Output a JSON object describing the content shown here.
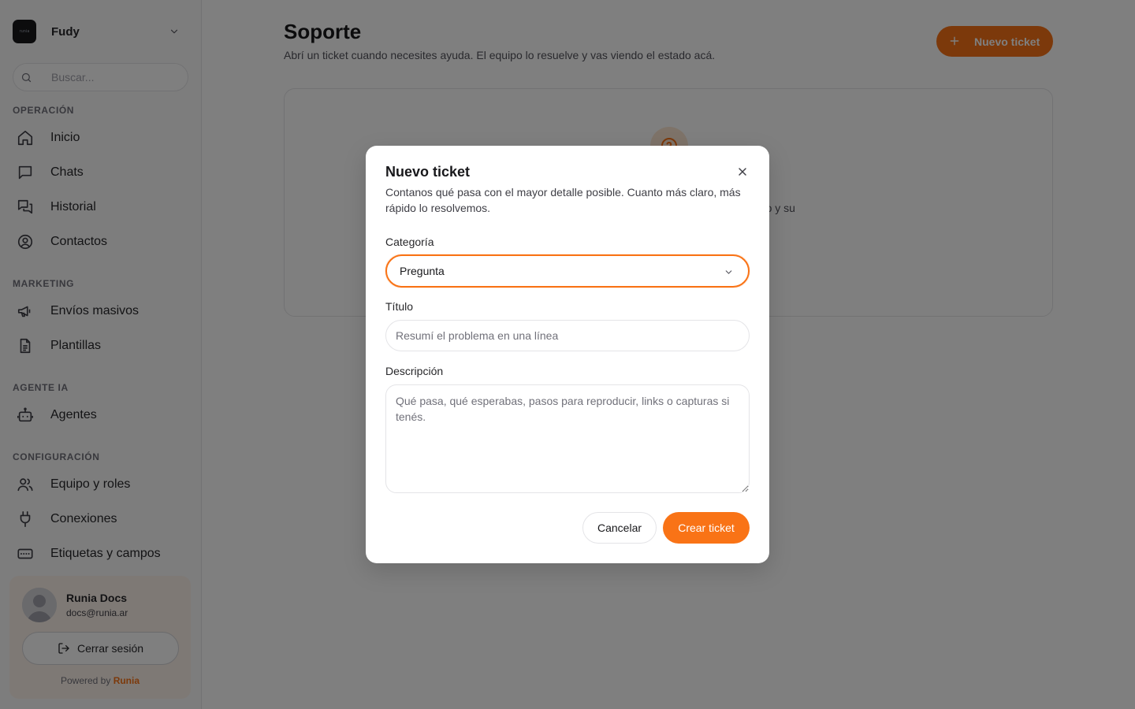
{
  "sidebar": {
    "workspace": {
      "logo_text": "runia",
      "name": "Fudy",
      "icon": "chevron-down-icon"
    },
    "search": {
      "placeholder": "Buscar...",
      "icon": "search-icon"
    },
    "sections": [
      {
        "label": "OPERACIÓN"
      },
      {
        "label": "MARKETING"
      },
      {
        "label": "AGENTE IA"
      },
      {
        "label": "CONFIGURACIÓN"
      }
    ],
    "items": [
      {
        "label": "Inicio",
        "icon": "home-icon"
      },
      {
        "label": "Chats",
        "icon": "chat-icon"
      },
      {
        "label": "Historial",
        "icon": "messages-icon"
      },
      {
        "label": "Contactos",
        "icon": "user-circle-icon"
      },
      {
        "label": "Envíos masivos",
        "icon": "megaphone-icon"
      },
      {
        "label": "Plantillas",
        "icon": "document-icon"
      },
      {
        "label": "Agentes",
        "icon": "bot-icon"
      },
      {
        "label": "Equipo y roles",
        "icon": "users-icon"
      },
      {
        "label": "Conexiones",
        "icon": "plug-icon"
      },
      {
        "label": "Etiquetas y campos",
        "icon": "tag-fields-icon"
      }
    ],
    "user": {
      "name": "Runia Docs",
      "email": "docs@runia.ar",
      "logout_label": "Cerrar sesión",
      "powered_prefix": "Powered by",
      "powered_brand": "Runia"
    }
  },
  "main": {
    "title": "Soporte",
    "subtitle": "Abrí un ticket cuando necesites ayuda. El equipo lo resuelve y vas viendo el estado acá.",
    "new_ticket_label": "Nuevo ticket",
    "empty_text_visible": "ado y su"
  },
  "modal": {
    "title": "Nuevo ticket",
    "description": "Contanos qué pasa con el mayor detalle posible. Cuanto más claro, más rápido lo resolvemos.",
    "category_label": "Categoría",
    "category_value": "Pregunta",
    "title_label": "Título",
    "title_placeholder": "Resumí el problema en una línea",
    "description_label": "Descripción",
    "description_placeholder": "Qué pasa, qué esperabas, pasos para reproducir, links o capturas si tenés.",
    "cancel_label": "Cancelar",
    "create_label": "Crear ticket"
  },
  "colors": {
    "accent": "#f97316",
    "overlay": "rgba(0,0,0,0.5)",
    "sidebar_bg": "#fafafa",
    "user_card_bg": "#fdf3ea"
  }
}
